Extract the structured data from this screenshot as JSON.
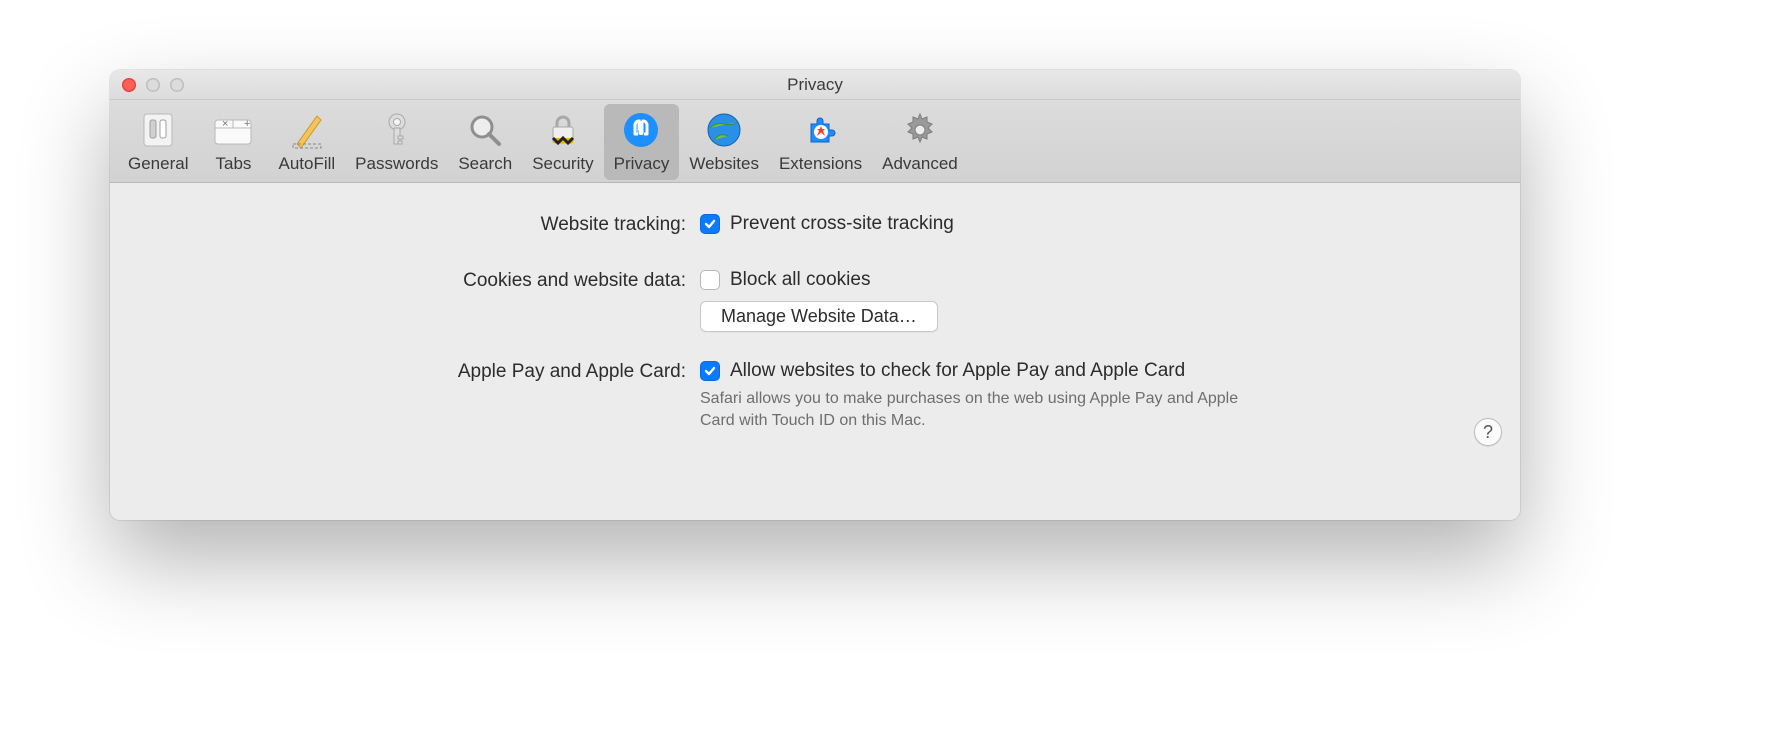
{
  "window": {
    "title": "Privacy"
  },
  "toolbar": {
    "items": [
      {
        "id": "general",
        "label": "General",
        "selected": false
      },
      {
        "id": "tabs",
        "label": "Tabs",
        "selected": false
      },
      {
        "id": "autofill",
        "label": "AutoFill",
        "selected": false
      },
      {
        "id": "passwords",
        "label": "Passwords",
        "selected": false
      },
      {
        "id": "search",
        "label": "Search",
        "selected": false
      },
      {
        "id": "security",
        "label": "Security",
        "selected": false
      },
      {
        "id": "privacy",
        "label": "Privacy",
        "selected": true
      },
      {
        "id": "websites",
        "label": "Websites",
        "selected": false
      },
      {
        "id": "extensions",
        "label": "Extensions",
        "selected": false
      },
      {
        "id": "advanced",
        "label": "Advanced",
        "selected": false
      }
    ]
  },
  "sections": {
    "tracking": {
      "label": "Website tracking:",
      "checkbox_label": "Prevent cross-site tracking",
      "checked": true
    },
    "cookies": {
      "label": "Cookies and website data:",
      "checkbox_label": "Block all cookies",
      "checked": false,
      "button_label": "Manage Website Data…"
    },
    "applepay": {
      "label": "Apple Pay and Apple Card:",
      "checkbox_label": "Allow websites to check for Apple Pay and Apple Card",
      "checked": true,
      "subtext": "Safari allows you to make purchases on the web using Apple Pay and Apple Card with Touch ID on this Mac."
    }
  },
  "help_button": "?"
}
